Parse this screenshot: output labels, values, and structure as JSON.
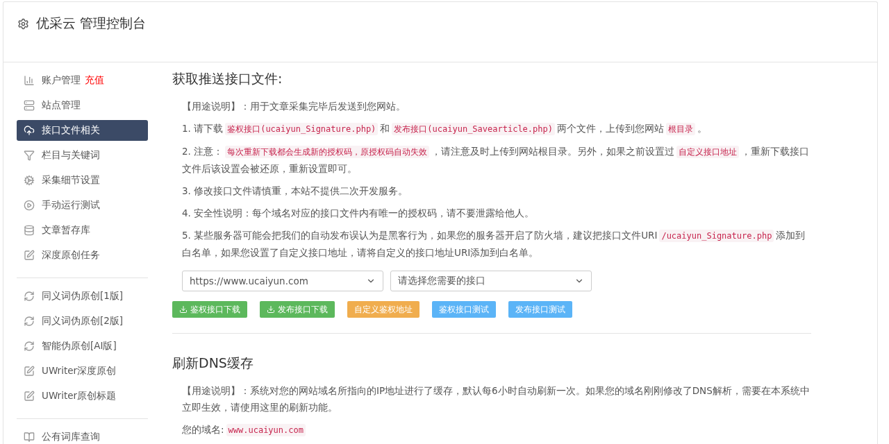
{
  "header": {
    "title": "优采云 管理控制台"
  },
  "sidebar": {
    "groups": [
      [
        {
          "label": "账户管理",
          "badge": "充值",
          "kind": "chart",
          "selected": false
        },
        {
          "label": "站点管理",
          "kind": "server",
          "selected": false
        },
        {
          "label": "接口文件相关",
          "kind": "cloud",
          "selected": true
        },
        {
          "label": "栏目与关键词",
          "kind": "filter",
          "selected": false
        },
        {
          "label": "采集细节设置",
          "kind": "gears",
          "selected": false
        },
        {
          "label": "手动运行测试",
          "kind": "play",
          "selected": false
        },
        {
          "label": "文章暂存库",
          "kind": "database",
          "selected": false
        },
        {
          "label": "深度原创任务",
          "kind": "edit",
          "selected": false
        }
      ],
      [
        {
          "label": "同义词伪原创[1版]",
          "kind": "refresh",
          "selected": false
        },
        {
          "label": "同义词伪原创[2版]",
          "kind": "refresh",
          "selected": false
        },
        {
          "label": "智能伪原创[AI版]",
          "kind": "refresh",
          "selected": false
        },
        {
          "label": "UWriter深度原创",
          "kind": "edit",
          "selected": false
        },
        {
          "label": "UWriter原创标题",
          "kind": "edit",
          "selected": false
        }
      ],
      [
        {
          "label": "公有词库查询",
          "kind": "book",
          "selected": false
        }
      ]
    ]
  },
  "push_section": {
    "heading": "获取推送接口文件:",
    "paragraphs": [
      [
        {
          "kind": "plain",
          "text": "【用途说明】：用于文章采集完毕后发送到您网站。"
        }
      ],
      [
        {
          "kind": "plain",
          "text": "1. 请下载"
        },
        {
          "kind": "code",
          "text": "鉴权接口(ucaiyun_Signature.php)"
        },
        {
          "kind": "plain",
          "text": "和"
        },
        {
          "kind": "code",
          "text": "发布接口(ucaiyun_Savearticle.php)"
        },
        {
          "kind": "plain",
          "text": "两个文件，上传到您网站"
        },
        {
          "kind": "code",
          "text": "根目录"
        },
        {
          "kind": "plain",
          "text": "。"
        }
      ],
      [
        {
          "kind": "plain",
          "text": "2. 注意："
        },
        {
          "kind": "code",
          "text": "每次重新下载都会生成新的授权码，原授权码自动失效"
        },
        {
          "kind": "plain",
          "text": "，请注意及时上传到网站根目录。另外，如果之前设置过"
        },
        {
          "kind": "code",
          "text": "自定义接口地址"
        },
        {
          "kind": "plain",
          "text": "，重新下载接口文件后该设置会被还原，重新设置即可。"
        }
      ],
      [
        {
          "kind": "plain",
          "text": "3. 修改接口文件请慎重，本站不提供二次开发服务。"
        }
      ],
      [
        {
          "kind": "plain",
          "text": "4. 安全性说明：每个域名对应的接口文件内有唯一的授权码，请不要泄露给他人。"
        }
      ],
      [
        {
          "kind": "plain",
          "text": "5. 某些服务器可能会把我们的自动发布误认为是黑客行为，如果您的服务器开启了防火墙，建议把接口文件URI"
        },
        {
          "kind": "code",
          "text": "/ucaiyun_Signature.php"
        },
        {
          "kind": "plain",
          "text": "添加到白名单，如果您设置了自定义接口地址，请将自定义的接口地址URI添加到白名单。"
        }
      ]
    ],
    "site_select": {
      "value": "https://www.ucaiyun.com"
    },
    "interface_select": {
      "placeholder": "请选择您需要的接口"
    },
    "buttons": [
      {
        "label": "鉴权接口下载",
        "kind": "download"
      },
      {
        "label": "发布接口下载",
        "kind": "download"
      },
      {
        "label": "自定义鉴权地址",
        "kind": "warning"
      },
      {
        "label": "鉴权接口测试",
        "kind": "info"
      },
      {
        "label": "发布接口测试",
        "kind": "info"
      }
    ]
  },
  "dns_section": {
    "heading": "刷新DNS缓存",
    "paragraphs": [
      [
        {
          "kind": "plain",
          "text": "【用途说明】：系统对您的网站域名所指向的IP地址进行了缓存，默认每6小时自动刷新一次。如果您的域名刚刚修改了DNS解析，需要在本系统中立即生效，请使用这里的刷新功能。"
        }
      ],
      [
        {
          "kind": "plain",
          "text": "您的域名:"
        },
        {
          "kind": "code",
          "text": "www.ucaiyun.com"
        }
      ]
    ]
  }
}
